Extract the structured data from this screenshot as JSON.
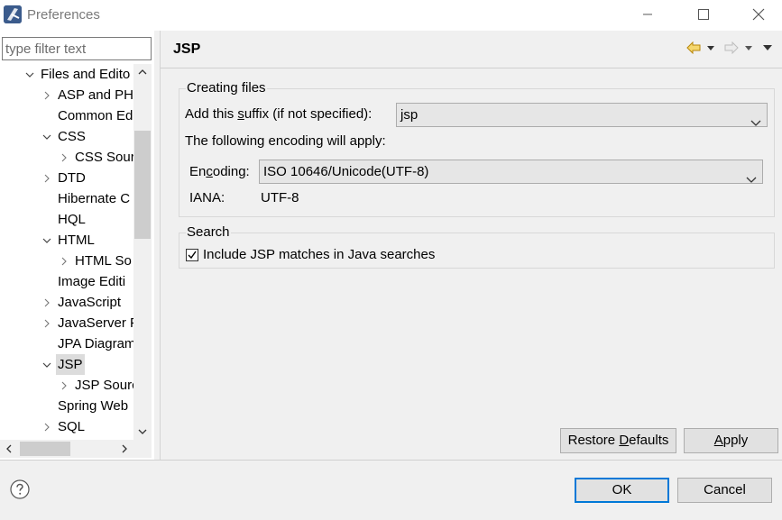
{
  "window": {
    "title": "Preferences"
  },
  "filter": {
    "placeholder": "type filter text"
  },
  "tree": {
    "items": [
      {
        "label": "Files and Edito",
        "expanded": true
      },
      {
        "label": "ASP and PH",
        "expanded": false
      },
      {
        "label": "Common Ed"
      },
      {
        "label": "CSS",
        "expanded": true
      },
      {
        "label": "CSS Sour",
        "expanded": false
      },
      {
        "label": "DTD",
        "expanded": false
      },
      {
        "label": "Hibernate C"
      },
      {
        "label": "HQL"
      },
      {
        "label": "HTML",
        "expanded": true
      },
      {
        "label": "HTML So",
        "expanded": false
      },
      {
        "label": "Image Editi"
      },
      {
        "label": "JavaScript",
        "expanded": false
      },
      {
        "label": "JavaServer F",
        "expanded": false
      },
      {
        "label": "JPA Diagram"
      },
      {
        "label": "JSP",
        "expanded": true,
        "selected": true
      },
      {
        "label": "JSP Sourc",
        "expanded": false
      },
      {
        "label": "Spring Web"
      },
      {
        "label": "SQL",
        "expanded": false
      }
    ]
  },
  "page": {
    "title": "JSP",
    "creating_files": {
      "group_title": "Creating files",
      "suffix_label_pre": "Add this ",
      "suffix_label_mnemonic": "s",
      "suffix_label_post": "uffix (if not specified):",
      "suffix_value": "jsp",
      "encoding_note": "The following encoding will apply:",
      "encoding_label_pre": "En",
      "encoding_label_mnemonic": "c",
      "encoding_label_post": "oding:",
      "encoding_value": "ISO 10646/Unicode(UTF-8)",
      "iana_label": "IANA:",
      "iana_value": "UTF-8"
    },
    "search": {
      "group_title": "Search",
      "checkbox_label": "Include JSP matches in Java searches",
      "checked": true
    }
  },
  "buttons": {
    "restore_pre": "Restore ",
    "restore_mnemonic": "D",
    "restore_post": "efaults",
    "apply_mnemonic": "A",
    "apply_post": "pply",
    "ok": "OK",
    "cancel": "Cancel"
  },
  "colors": {
    "nav_arrow_active": "#d4a017",
    "nav_arrow_inactive": "#c8c8c8",
    "default_button_border": "#0078d7",
    "selection_bg": "#dcdcdc"
  }
}
